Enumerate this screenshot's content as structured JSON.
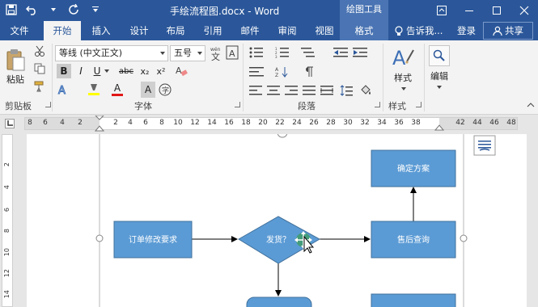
{
  "window": {
    "title": "手绘流程图.docx - Word",
    "context_tool": "绘图工具"
  },
  "tabs": [
    {
      "label": "文件"
    },
    {
      "label": "开始"
    },
    {
      "label": "插入"
    },
    {
      "label": "设计"
    },
    {
      "label": "布局"
    },
    {
      "label": "引用"
    },
    {
      "label": "邮件"
    },
    {
      "label": "审阅"
    },
    {
      "label": "视图"
    },
    {
      "label": "格式"
    }
  ],
  "tell_me": "告诉我...",
  "login": "登录",
  "share": "共享",
  "ribbon": {
    "paste": "粘贴",
    "font_name": "等线 (中文正文)",
    "font_size": "五号",
    "bold": "B",
    "italic": "I",
    "underline": "U",
    "strike": "abc",
    "subscript": "x₂",
    "superscript": "x²",
    "font_color_letter": "A",
    "char_shading_letter": "A",
    "styles": "样式",
    "editing": "编辑",
    "groups": {
      "clipboard": "剪贴板",
      "font": "字体",
      "paragraph": "段落",
      "styles": "样式"
    }
  },
  "ruler": {
    "h_ticks": [
      "8",
      "6",
      "4",
      "2",
      "2",
      "4",
      "6",
      "8",
      "10",
      "12",
      "14",
      "16",
      "18",
      "20",
      "22",
      "24",
      "26",
      "28",
      "30",
      "32",
      "34",
      "36",
      "38",
      "42",
      "44",
      "46",
      "48"
    ],
    "v_ticks": [
      "2",
      "4",
      "6",
      "8",
      "10",
      "12",
      "14"
    ]
  },
  "flowchart": {
    "nodes": {
      "order_change": "订单修改要求",
      "ship_decision": "发货？",
      "after_sales": "售后查询",
      "confirm_plan": "确定方案"
    }
  },
  "colors": {
    "title_bar": "#2b579a",
    "shape_fill": "#5b9bd5",
    "shape_border": "#41719c"
  }
}
